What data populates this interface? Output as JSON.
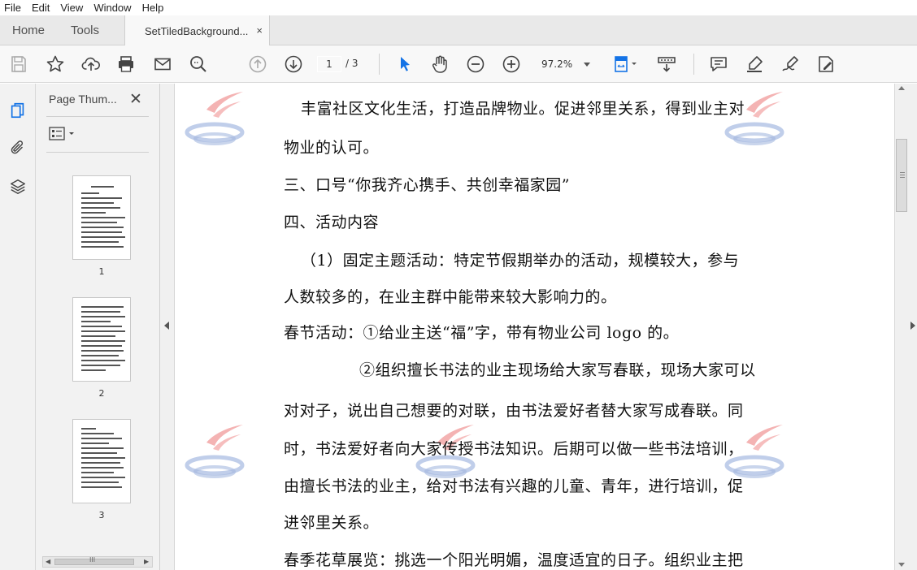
{
  "menu": [
    "File",
    "Edit",
    "View",
    "Window",
    "Help"
  ],
  "tabs": {
    "home": "Home",
    "tools": "Tools",
    "document": "SetTiledBackground...",
    "close": "×"
  },
  "toolbar": {
    "page_current": "1",
    "page_total": "/ 3",
    "zoom": "97.2%"
  },
  "thumbnail_panel": {
    "title": "Page Thum...",
    "close": "✕",
    "pages": [
      "1",
      "2",
      "3"
    ]
  },
  "scrollbar": {
    "grip": "III"
  },
  "document": {
    "lines": [
      "丰富社区文化生活，打造品牌物业。促进邻里关系，得到业主对",
      "物业的认可。",
      "三、口号“你我齐心携手、共创幸福家园”",
      "四、活动内容",
      "（1）固定主题活动：特定节假期举办的活动，规模较大，参与",
      "人数较多的，在业主群中能带来较大影响力的。",
      "春节活动：①给业主送“福”字，带有物业公司 logo 的。",
      "②组织擅长书法的业主现场给大家写春联，现场大家可以",
      "对对子，说出自己想要的对联，由书法爱好者替大家写成春联。同",
      "时，书法爱好者向大家传授书法知识。后期可以做一些书法培训，",
      "由擅长书法的业主，给对书法有兴趣的儿童、青年，进行培训，促",
      "进邻里关系。",
      "春季花草展览：挑选一个阳光明媚，温度适宜的日子。组织业主把"
    ]
  },
  "colors": {
    "accent_blue": "#1473e6",
    "watermark_red": "#e23b3b",
    "watermark_blue": "#5b7fc7"
  }
}
